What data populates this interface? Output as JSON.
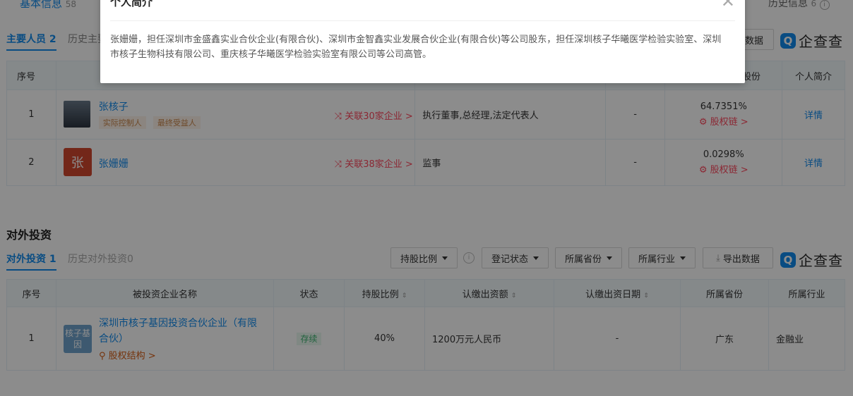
{
  "top": {
    "basic_info_label": "基本信息",
    "basic_info_count": "58",
    "history_label": "历史信息",
    "history_count": "6",
    "history_info_icon": "info-circle-icon"
  },
  "people_section": {
    "tab_active_label": "主要人员",
    "tab_active_count": "2",
    "tab_history_label": "历史主要",
    "export_label": "数据",
    "logo_text": "企查查",
    "headers": {
      "index": "序号",
      "share": "股份",
      "bio": "个人简介"
    },
    "rows": [
      {
        "index": "1",
        "name": "张核子",
        "tags": [
          "实际控制人",
          "最终受益人"
        ],
        "related": "关联30家企业 >",
        "position": "执行董事,总经理,法定代表人",
        "dash": "-",
        "ratio": "64.7351%",
        "chain": "股权链 >",
        "detail": "详情",
        "avatar_char": ""
      },
      {
        "index": "2",
        "name": "张姗姗",
        "tags": [],
        "related": "关联38家企业 >",
        "position": "监事",
        "dash": "-",
        "ratio": "0.0298%",
        "chain": "股权链 >",
        "detail": "详情",
        "avatar_char": "张"
      }
    ]
  },
  "invest_section": {
    "title": "对外投资",
    "tab_active_label": "对外投资",
    "tab_active_count": "1",
    "tab_history_label": "历史对外投资0",
    "filters": [
      "持股比例",
      "登记状态",
      "所属省份",
      "所属行业"
    ],
    "export_label": "导出数据",
    "logo_text": "企查查",
    "headers": [
      "序号",
      "被投资企业名称",
      "状态",
      "持股比例",
      "认缴出资额",
      "认缴出资日期",
      "所属省份",
      "所属行业"
    ],
    "rows": [
      {
        "index": "1",
        "logo_text": "核子基因",
        "company": "深圳市核子基因投资合伙企业（有限合伙）",
        "equity": "股权结构 >",
        "status": "存续",
        "ratio": "40%",
        "capital": "1200万元人民币",
        "date": "-",
        "province": "广东",
        "industry": "金融业"
      }
    ]
  },
  "modal": {
    "title": "个人简介",
    "close_icon": "close-icon",
    "body": "张姗姗，担任深圳市金盛鑫实业合伙企业(有限合伙)、深圳市金智鑫实业发展合伙企业(有限合伙)等公司股东，担任深圳核子华曦医学检验实验室、深圳市核子生物科技有限公司、重庆核子华曦医学检验实验室有限公司等公司高管。"
  },
  "colors": {
    "accent": "#128bed",
    "tag_bg": "#fdf2e9",
    "status_bg": "#e9f7ee",
    "status_fg": "#3cb371",
    "link_red": "#fd485e"
  }
}
